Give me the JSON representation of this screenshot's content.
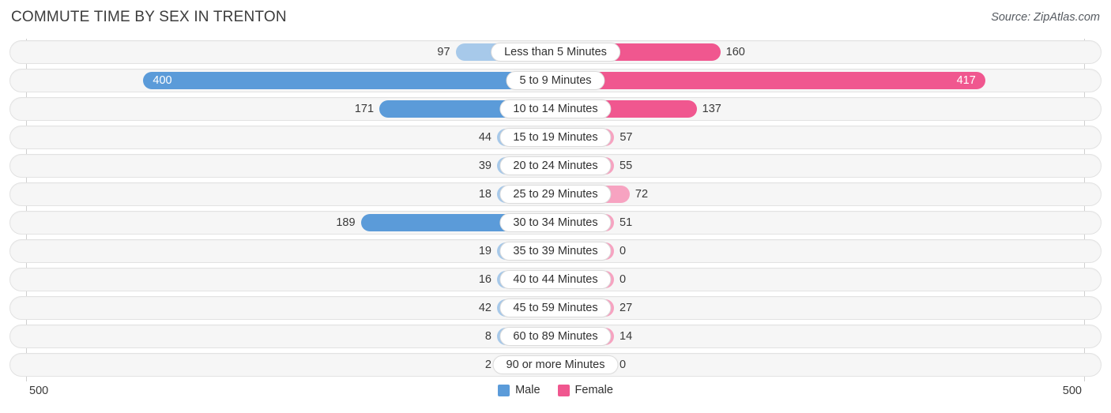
{
  "header": {
    "title": "COMMUTE TIME BY SEX IN TRENTON",
    "source": "Source: ZipAtlas.com"
  },
  "legend": {
    "male_label": "Male",
    "female_label": "Female",
    "male_color": "#5b9bd9",
    "female_color": "#f0578f"
  },
  "axis": {
    "left_label": "500",
    "right_label": "500",
    "max": 500
  },
  "chart_data": {
    "type": "bar",
    "subtype": "diverging-bidirectional",
    "title": "COMMUTE TIME BY SEX IN TRENTON",
    "xlabel": "",
    "ylabel": "",
    "xlim": [
      500,
      500
    ],
    "grid": false,
    "legend_position": "bottom-center",
    "categories": [
      "Less than 5 Minutes",
      "5 to 9 Minutes",
      "10 to 14 Minutes",
      "15 to 19 Minutes",
      "20 to 24 Minutes",
      "25 to 29 Minutes",
      "30 to 34 Minutes",
      "35 to 39 Minutes",
      "40 to 44 Minutes",
      "45 to 59 Minutes",
      "60 to 89 Minutes",
      "90 or more Minutes"
    ],
    "series": [
      {
        "name": "Male",
        "direction": "left",
        "color": "#5b9bd9",
        "light_color": "#a7c9ea",
        "values": [
          97,
          400,
          171,
          44,
          39,
          18,
          189,
          19,
          16,
          42,
          8,
          2
        ]
      },
      {
        "name": "Female",
        "direction": "right",
        "color": "#f0578f",
        "light_color": "#f7a3c1",
        "values": [
          160,
          417,
          137,
          57,
          55,
          72,
          51,
          0,
          0,
          27,
          14,
          0
        ]
      }
    ]
  },
  "rows": [
    {
      "category": "Less than 5 Minutes",
      "male": "97",
      "female": "160",
      "male_inside": false,
      "female_inside": false,
      "male_strong": false,
      "female_strong": true
    },
    {
      "category": "5 to 9 Minutes",
      "male": "400",
      "female": "417",
      "male_inside": true,
      "female_inside": true,
      "male_strong": true,
      "female_strong": true
    },
    {
      "category": "10 to 14 Minutes",
      "male": "171",
      "female": "137",
      "male_inside": false,
      "female_inside": false,
      "male_strong": true,
      "female_strong": true
    },
    {
      "category": "15 to 19 Minutes",
      "male": "44",
      "female": "57",
      "male_inside": false,
      "female_inside": false,
      "male_strong": false,
      "female_strong": false
    },
    {
      "category": "20 to 24 Minutes",
      "male": "39",
      "female": "55",
      "male_inside": false,
      "female_inside": false,
      "male_strong": false,
      "female_strong": false
    },
    {
      "category": "25 to 29 Minutes",
      "male": "18",
      "female": "72",
      "male_inside": false,
      "female_inside": false,
      "male_strong": false,
      "female_strong": false
    },
    {
      "category": "30 to 34 Minutes",
      "male": "189",
      "female": "51",
      "male_inside": false,
      "female_inside": false,
      "male_strong": true,
      "female_strong": false
    },
    {
      "category": "35 to 39 Minutes",
      "male": "19",
      "female": "0",
      "male_inside": false,
      "female_inside": false,
      "male_strong": false,
      "female_strong": false
    },
    {
      "category": "40 to 44 Minutes",
      "male": "16",
      "female": "0",
      "male_inside": false,
      "female_inside": false,
      "male_strong": false,
      "female_strong": false
    },
    {
      "category": "45 to 59 Minutes",
      "male": "42",
      "female": "27",
      "male_inside": false,
      "female_inside": false,
      "male_strong": false,
      "female_strong": false
    },
    {
      "category": "60 to 89 Minutes",
      "male": "8",
      "female": "14",
      "male_inside": false,
      "female_inside": false,
      "male_strong": false,
      "female_strong": false
    },
    {
      "category": "90 or more Minutes",
      "male": "2",
      "female": "0",
      "male_inside": false,
      "female_inside": false,
      "male_strong": false,
      "female_strong": false
    }
  ]
}
